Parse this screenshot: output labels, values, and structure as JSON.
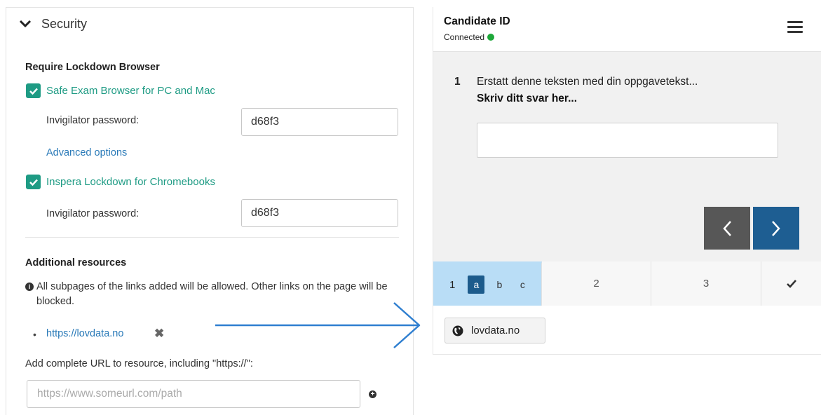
{
  "security": {
    "section_title": "Security",
    "lockdown_heading": "Require Lockdown Browser",
    "seb": {
      "label": "Safe Exam Browser for PC and Mac",
      "password_label": "Invigilator password:",
      "password_value": "d68f3",
      "advanced_link": "Advanced options"
    },
    "chromebook": {
      "label": "Inspera Lockdown for Chromebooks",
      "password_label": "Invigilator password:",
      "password_value": "d68f3"
    },
    "resources_heading": "Additional resources",
    "info_text": "All subpages of the links added will be allowed. Other links on the page will be blocked.",
    "resource_links": [
      "https://lovdata.no"
    ],
    "add_url_label": "Add complete URL to resource, including \"https://\":",
    "url_placeholder": "https://www.someurl.com/path"
  },
  "candidate": {
    "title": "Candidate ID",
    "status": "Connected",
    "status_color": "#1ea83a",
    "question_number": "1",
    "question_text": "Erstatt denne teksten med din oppgavetekst...",
    "answer_prompt": "Skriv ditt svar her...",
    "tabs": {
      "first_number": "1",
      "subitems": [
        "a",
        "b",
        "c"
      ],
      "second": "2",
      "third": "3"
    },
    "resource_button": "lovdata.no"
  },
  "colors": {
    "accent_teal": "#1e9b84",
    "link_blue": "#2a7ab8",
    "nav_next": "#1e5e92",
    "active_tab": "#b9ddf6"
  }
}
